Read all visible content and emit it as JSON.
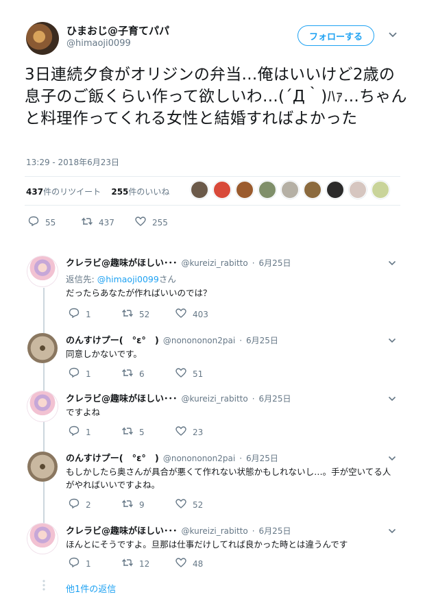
{
  "tweet": {
    "author_name": "ひまおじ@子育てパパ",
    "author_handle": "@himaoji0099",
    "follow_label": "フォローする",
    "text": "3日連続夕食がオリジンの弁当…俺はいいけど2歳の息子のご飯くらい作って欲しいわ…(´Д｀)ﾊｧ…ちゃんと料理作ってくれる女性と結婚すればよかった",
    "timestamp": "13:29 - 2018年6月23日",
    "retweets_num": "437",
    "retweets_label": "件のリツイート",
    "likes_num": "255",
    "likes_label": "件のいいね",
    "reply_count": "55",
    "retweet_count": "437",
    "like_count": "255",
    "liker_colors": [
      "#6b5a4a",
      "#d84a3a",
      "#9a5b2e",
      "#7f8f6a",
      "#b5b0a5",
      "#8b6a3e",
      "#2a2a2a",
      "#d6c6c0",
      "#c9d49a"
    ]
  },
  "icons": {
    "chevron": "chevron-down-icon",
    "reply": "reply-icon",
    "retweet": "retweet-icon",
    "like": "heart-icon"
  },
  "replies": [
    {
      "name": "クレラビ@趣味がほしい･･･",
      "handle": "@kureizi_rabitto",
      "date": "6月25日",
      "reply_to_prefix": "返信先: ",
      "reply_to_handle": "@himaoji0099",
      "reply_to_suffix": "さん",
      "text": "だったらあなたが作ればいいのでは？",
      "reply_count": "1",
      "retweet_count": "52",
      "like_count": "403"
    },
    {
      "name": "のんすけプー(　°ε°　)",
      "handle": "@nonononon2pai",
      "date": "6月25日",
      "text": "同意しかないです。",
      "reply_count": "1",
      "retweet_count": "6",
      "like_count": "51"
    },
    {
      "name": "クレラビ@趣味がほしい･･･",
      "handle": "@kureizi_rabitto",
      "date": "6月25日",
      "text": "ですよね",
      "reply_count": "1",
      "retweet_count": "5",
      "like_count": "23"
    },
    {
      "name": "のんすけプー(　°ε°　)",
      "handle": "@nonononon2pai",
      "date": "6月25日",
      "text": "もしかしたら奥さんが具合が悪くて作れない状態かもしれないし…。手が空いてる人がやればいいですよね。",
      "reply_count": "2",
      "retweet_count": "9",
      "like_count": "52"
    },
    {
      "name": "クレラビ@趣味がほしい･･･",
      "handle": "@kureizi_rabitto",
      "date": "6月25日",
      "text": "ほんとにそうですよ。旦那は仕事だけしてれば良かった時とは違うんです",
      "reply_count": "1",
      "retweet_count": "12",
      "like_count": "48"
    }
  ],
  "more_replies_label": "他1件の返信",
  "separator": " · "
}
